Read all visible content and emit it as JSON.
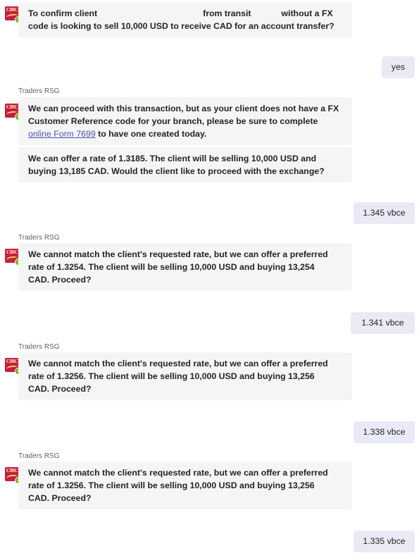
{
  "sender_name": "Traders RSG",
  "avatar": {
    "logo_text": "CIBC",
    "status": "available"
  },
  "messages": [
    {
      "type": "incoming",
      "show_sender": false,
      "parts": [
        {
          "p1": "To confirm client",
          "p2": "from transit",
          "p3": "without a FX",
          "p4": "code is looking to sell 10,000 USD to receive CAD for an account transfer?"
        }
      ]
    },
    {
      "type": "outgoing",
      "text": "yes"
    },
    {
      "type": "incoming",
      "show_sender": true,
      "bubble1": {
        "line1": "We can proceed with this transaction, but as your client does not have a FX",
        "line2": "Customer Reference code for your branch, please be sure to complete",
        "link": "online Form 7699",
        "line3_tail": " to have one created today."
      },
      "bubble2": {
        "line1": "We can offer a rate of 1.3185. The client will be selling 10,000 USD and",
        "line2": "buying 13,185 CAD. Would the client like to proceed with the exchange?"
      }
    },
    {
      "type": "outgoing",
      "text": "1.345 vbce"
    },
    {
      "type": "incoming",
      "show_sender": true,
      "line1": "We cannot match the client's requested rate, but we can offer a preferred",
      "line2": "rate of 1.3254. The client will be selling 10,000 USD and buying 13,254",
      "line3": "CAD. Proceed?"
    },
    {
      "type": "outgoing",
      "text": "1.341 vbce"
    },
    {
      "type": "incoming",
      "show_sender": true,
      "line1": "We cannot match the client's requested rate, but we can offer a preferred",
      "line2": "rate of 1.3256. The client will be selling 10,000 USD and buying 13,256",
      "line3": "CAD. Proceed?"
    },
    {
      "type": "outgoing",
      "text": "1.338 vbce"
    },
    {
      "type": "incoming",
      "show_sender": true,
      "line1": "We cannot match the client's requested rate, but we can offer a preferred",
      "line2": "rate of 1.3256. The client will be selling 10,000 USD and buying 13,256",
      "line3": "CAD. Proceed?"
    },
    {
      "type": "outgoing",
      "text": "1.335 vbce"
    }
  ],
  "colors": {
    "incoming_bubble": "#f5f5f5",
    "outgoing_bubble": "#e9eaf6",
    "link": "#4f52b2",
    "brand_red": "#c41f3e",
    "status_green": "#6bb700"
  }
}
